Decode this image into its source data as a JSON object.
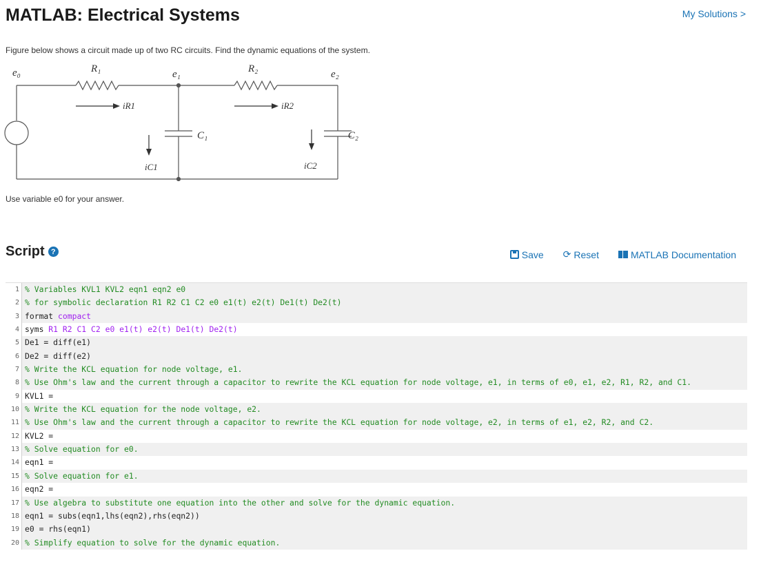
{
  "header": {
    "title": "MATLAB: Electrical Systems",
    "my_solutions": "My Solutions >"
  },
  "problem": {
    "prompt": "Figure below shows a circuit made up of two RC circuits. Find the dynamic equations of the system.",
    "hint": "Use variable e0 for your answer."
  },
  "circuit": {
    "labels": {
      "e0": "e₀",
      "e1": "e₁",
      "e2": "e₂",
      "R1": "R₁",
      "R2": "R₂",
      "iR1": "iR1",
      "iR2": "iR2",
      "iC1": "iC1",
      "iC2": "iC2",
      "C1": "C₁",
      "C2": "C₂"
    }
  },
  "script": {
    "title": "Script",
    "help_icon": "question-icon",
    "toolbar": {
      "save": "Save",
      "reset": "Reset",
      "docs": "MATLAB Documentation"
    }
  },
  "code_lines": [
    {
      "n": "1",
      "segs": [
        {
          "c": "cmt",
          "t": "% Variables KVL1 KVL2 eqn1 eqn2 e0"
        }
      ]
    },
    {
      "n": "2",
      "segs": [
        {
          "c": "cmt",
          "t": "% for symbolic declaration R1 R2 C1 C2 e0 e1(t) e2(t) De1(t) De2(t)"
        }
      ]
    },
    {
      "n": "3",
      "segs": [
        {
          "c": "txt",
          "t": "format "
        },
        {
          "c": "kw",
          "t": "compact"
        }
      ]
    },
    {
      "n": "4",
      "plain": true,
      "segs": [
        {
          "c": "txt",
          "t": "syms "
        },
        {
          "c": "kw",
          "t": "R1 R2 C1 C2 e0 e1(t) e2(t) De1(t) De2(t)"
        }
      ]
    },
    {
      "n": "5",
      "segs": [
        {
          "c": "txt",
          "t": "De1 = diff(e1)"
        }
      ]
    },
    {
      "n": "6",
      "segs": [
        {
          "c": "txt",
          "t": "De2 = diff(e2)"
        }
      ]
    },
    {
      "n": "7",
      "segs": [
        {
          "c": "cmt",
          "t": "% Write the KCL equation for node voltage, e1."
        }
      ]
    },
    {
      "n": "8",
      "segs": [
        {
          "c": "cmt",
          "t": "% Use Ohm's law and the current through a capacitor to rewrite the KCL equation for node voltage, e1, in terms of e0, e1, e2, R1, R2, and C1."
        }
      ]
    },
    {
      "n": "9",
      "plain": true,
      "segs": [
        {
          "c": "txt",
          "t": "KVL1 = "
        }
      ]
    },
    {
      "n": "10",
      "segs": [
        {
          "c": "cmt",
          "t": "% Write the KCL equation for the node voltage, e2."
        }
      ]
    },
    {
      "n": "11",
      "segs": [
        {
          "c": "cmt",
          "t": "% Use Ohm's law and the current through a capacitor to rewrite the KCL equation for node voltage, e2, in terms of e1, e2, R2, and C2."
        }
      ]
    },
    {
      "n": "12",
      "plain": true,
      "segs": [
        {
          "c": "txt",
          "t": "KVL2 = "
        }
      ]
    },
    {
      "n": "13",
      "segs": [
        {
          "c": "cmt",
          "t": "% Solve equation for e0."
        }
      ]
    },
    {
      "n": "14",
      "plain": true,
      "segs": [
        {
          "c": "txt",
          "t": "eqn1 = "
        }
      ]
    },
    {
      "n": "15",
      "segs": [
        {
          "c": "cmt",
          "t": "% Solve equation for e1."
        }
      ]
    },
    {
      "n": "16",
      "plain": true,
      "segs": [
        {
          "c": "txt",
          "t": "eqn2 = "
        }
      ]
    },
    {
      "n": "17",
      "segs": [
        {
          "c": "cmt",
          "t": "% Use algebra to substitute one equation into the other and solve for the dynamic equation."
        }
      ]
    },
    {
      "n": "18",
      "segs": [
        {
          "c": "txt",
          "t": "eqn1 = subs(eqn1,lhs(eqn2),rhs(eqn2))"
        }
      ]
    },
    {
      "n": "19",
      "segs": [
        {
          "c": "txt",
          "t": "e0 = rhs(eqn1)"
        }
      ]
    },
    {
      "n": "20",
      "segs": [
        {
          "c": "cmt",
          "t": "% Simplify equation to solve for the dynamic equation."
        }
      ]
    }
  ],
  "colors": {
    "link": "#1a73b5",
    "comment": "#228b22",
    "keyword": "#a020f0"
  }
}
